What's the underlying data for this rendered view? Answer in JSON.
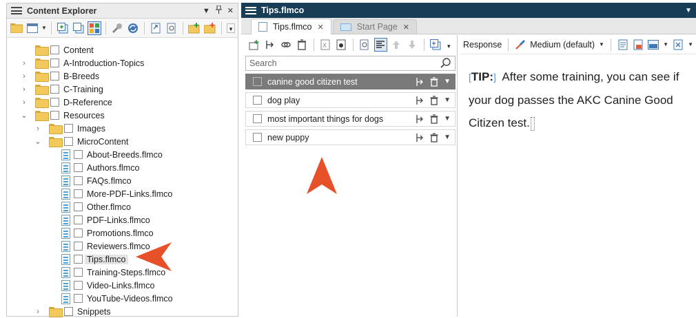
{
  "explorer": {
    "title": "Content Explorer",
    "pin_glyph": "▾",
    "close_glyph": "✕",
    "tree": [
      {
        "level": 0,
        "type": "folder",
        "label": "Content",
        "chevron": ""
      },
      {
        "level": 1,
        "type": "folder",
        "label": "A-Introduction-Topics",
        "chevron": "›"
      },
      {
        "level": 1,
        "type": "folder",
        "label": "B-Breeds",
        "chevron": "›"
      },
      {
        "level": 1,
        "type": "folder",
        "label": "C-Training",
        "chevron": "›"
      },
      {
        "level": 1,
        "type": "folder",
        "label": "D-Reference",
        "chevron": "›"
      },
      {
        "level": 1,
        "type": "folder",
        "label": "Resources",
        "chevron": "⌄"
      },
      {
        "level": 2,
        "type": "folder",
        "label": "Images",
        "chevron": "›"
      },
      {
        "level": 2,
        "type": "folder",
        "label": "MicroContent",
        "chevron": "⌄"
      },
      {
        "level": 3,
        "type": "file",
        "label": "About-Breeds.flmco"
      },
      {
        "level": 3,
        "type": "file",
        "label": "Authors.flmco"
      },
      {
        "level": 3,
        "type": "file",
        "label": "FAQs.flmco"
      },
      {
        "level": 3,
        "type": "file",
        "label": "More-PDF-Links.flmco"
      },
      {
        "level": 3,
        "type": "file",
        "label": "Other.flmco"
      },
      {
        "level": 3,
        "type": "file",
        "label": "PDF-Links.flmco"
      },
      {
        "level": 3,
        "type": "file",
        "label": "Promotions.flmco"
      },
      {
        "level": 3,
        "type": "file",
        "label": "Reviewers.flmco"
      },
      {
        "level": 3,
        "type": "file",
        "label": "Tips.flmco",
        "selected": true
      },
      {
        "level": 3,
        "type": "file",
        "label": "Training-Steps.flmco"
      },
      {
        "level": 3,
        "type": "file",
        "label": "Video-Links.flmco"
      },
      {
        "level": 3,
        "type": "file",
        "label": "YouTube-Videos.flmco"
      },
      {
        "level": 2,
        "type": "folder",
        "label": "Snippets",
        "chevron": "›"
      }
    ]
  },
  "editor": {
    "title": "Tips.flmco",
    "tabs": [
      {
        "label": "Tips.flmco",
        "active": true
      },
      {
        "label": "Start Page",
        "active": false
      }
    ],
    "search": {
      "placeholder": "Search"
    },
    "phrases": [
      {
        "label": "canine good citizen test",
        "selected": true
      },
      {
        "label": "dog play"
      },
      {
        "label": "most important things for dogs"
      },
      {
        "label": "new puppy"
      }
    ],
    "response_toolbar": {
      "response_label": "Response",
      "size_label": "Medium (default)"
    },
    "response": {
      "tip_label": "TIP:",
      "text": "After some training, you can see if your dog passes the AKC Canine Good Citizen test."
    }
  },
  "colors": {
    "editor_titlebar": "#173d57",
    "selected_phrase": "#7a7a7a",
    "callout_arrow": "#e8502a"
  }
}
